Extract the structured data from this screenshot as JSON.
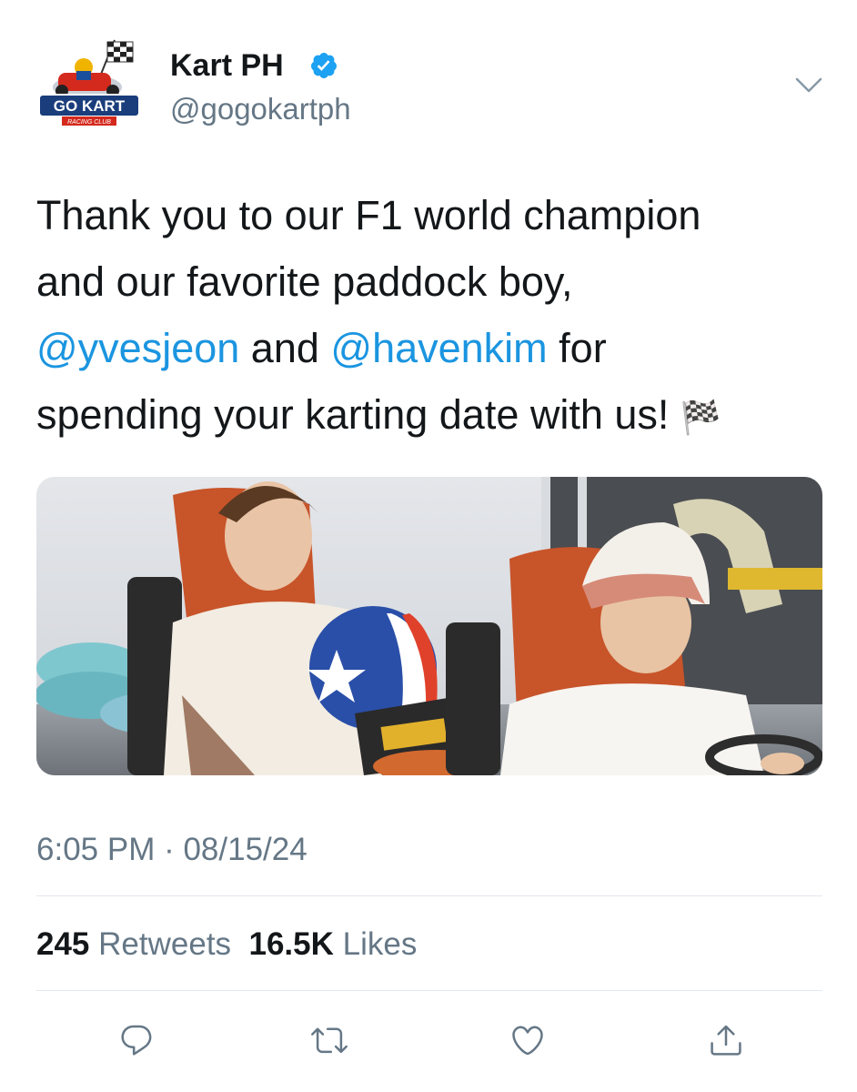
{
  "author": {
    "name": "Kart PH",
    "handle": "@gogokartph",
    "verified": true,
    "avatar_icon": "go-kart-logo-icon",
    "avatar_text": "GO KART",
    "avatar_subtext": "RACING CLUB"
  },
  "tweet": {
    "line1": "Thank you to our F1 world champion",
    "line2": "and our favorite paddock boy,",
    "mention1": "@yvesjeon",
    "and_text": " and ",
    "mention2": "@havenkim",
    "for_text": " for",
    "line4": "spending your karting date with us! ",
    "emoji": "🏁"
  },
  "media": {
    "type": "photo",
    "description_icon": "photo-two-drivers-in-go-karts"
  },
  "meta": {
    "timestamp": "6:05 PM · 08/15/24"
  },
  "stats": {
    "retweets_count": "245",
    "retweets_label": "Retweets",
    "likes_count": "16.5K",
    "likes_label": "Likes"
  },
  "colors": {
    "accent": "#1da1f2",
    "link": "#1b95e0",
    "secondary": "#657786",
    "divider": "#e1e8ed"
  }
}
